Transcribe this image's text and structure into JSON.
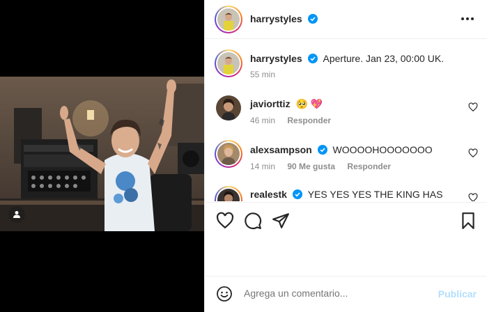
{
  "post": {
    "author": "harrystyles",
    "verified": true
  },
  "caption": {
    "author": "harrystyles",
    "text": "Aperture. Jan 23, 00:00 UK.",
    "time": "55 min"
  },
  "comments": [
    {
      "user": "javiorttiz",
      "text": "",
      "emojis": [
        "🥺",
        "💖"
      ],
      "time": "46 min",
      "likes": "",
      "reply": "Responder",
      "verified": false
    },
    {
      "user": "alexsampson",
      "text": "WOOOOHOOOOOOO",
      "time": "14 min",
      "likes": "90 Me gusta",
      "reply": "Responder",
      "verified": true
    },
    {
      "user": "realestk",
      "text": "YES YES YES THE KING HAS",
      "time": "",
      "likes": "",
      "reply": "",
      "verified": true
    }
  ],
  "composer": {
    "placeholder": "Agrega un comentario...",
    "publish_label": "Publicar"
  },
  "icons": {
    "more": "more-horizontal-icon",
    "like": "heart-icon",
    "comment": "comment-bubble-icon",
    "share": "paper-plane-icon",
    "save": "bookmark-icon",
    "emoji": "smiley-icon",
    "tag": "person-tag-icon",
    "verified": "verified-badge-icon"
  },
  "colors": {
    "verified": "#0095f6",
    "publish_disabled": "#b2dffc",
    "muted": "#8e8e8e",
    "text": "#262626"
  }
}
